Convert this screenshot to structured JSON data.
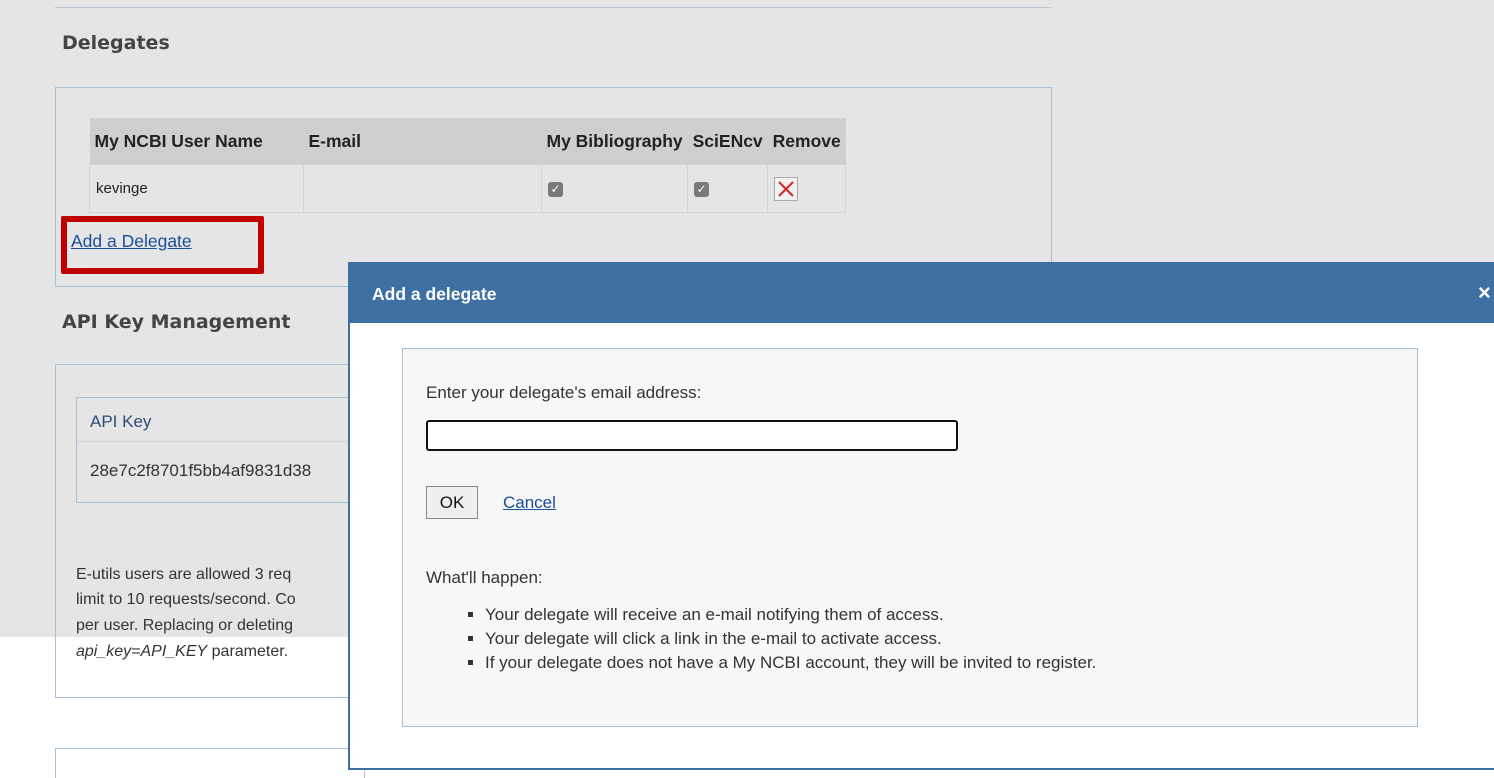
{
  "delegates": {
    "title": "Delegates",
    "table": {
      "headers": [
        "My NCBI User Name",
        "E-mail",
        "My Bibliography",
        "SciENcv",
        "Remove"
      ],
      "rows": [
        {
          "user_name": "kevinge",
          "email": "",
          "my_bibliography": true,
          "sciencv": true
        }
      ]
    },
    "add_link": "Add a Delegate",
    "highlight_color": "#c00000"
  },
  "api_key": {
    "title": "API Key Management",
    "header": "API Key",
    "value": "28e7c2f8701f5bb4af9831d38",
    "description_lines": [
      "E-utils users are allowed 3 req",
      "limit to 10 requests/second. Co",
      "per user. Replacing or deleting",
      "api_key=API_KEY parameter."
    ]
  },
  "dialog": {
    "title": "Add a delegate",
    "close_label": "×",
    "email_prompt": "Enter your delegate's email address:",
    "email_value": "",
    "ok_label": "OK",
    "cancel_label": "Cancel",
    "what_happens_label": "What'll happen:",
    "steps": [
      "Your delegate will receive an e-mail notifying them of access.",
      "Your delegate will click a link in the e-mail to activate access.",
      "If your delegate does not have a My NCBI account, they will be invited to register."
    ],
    "header_color": "#3e70a4"
  }
}
